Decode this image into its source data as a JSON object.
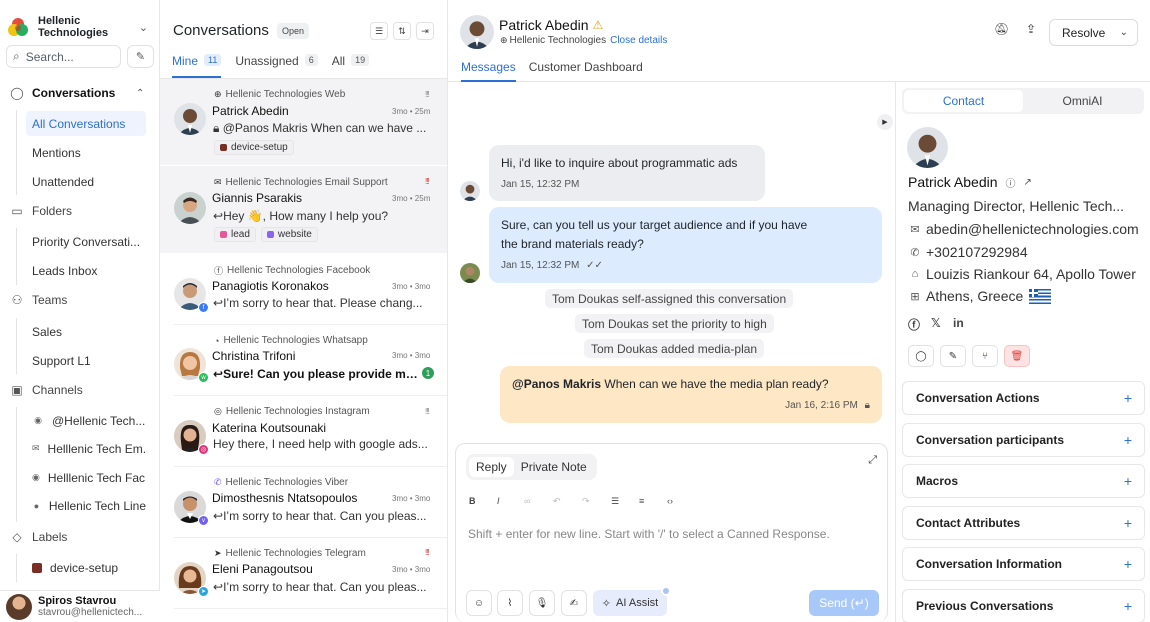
{
  "sidebar": {
    "org_name": "Hellenic Technologies",
    "search_placeholder": "Search...",
    "conversations_label": "Conversations",
    "conversation_items": [
      "All Conversations",
      "Mentions",
      "Unattended"
    ],
    "folders_label": "Folders",
    "folder_items": [
      "Priority Conversati...",
      "Leads Inbox"
    ],
    "teams_label": "Teams",
    "team_items": [
      "Sales",
      "Support L1"
    ],
    "channels_label": "Channels",
    "channel_items": [
      "@Hellenic Tech...",
      "Helllenic Tech Em...",
      "Helllenic Tech Fac...",
      "Hellenic Tech Line"
    ],
    "labels_label": "Labels",
    "label_items": [
      "device-setup"
    ],
    "user": {
      "name": "Spiros Stavrou",
      "email": "stavrou@hellenictech..."
    }
  },
  "conv_list": {
    "title": "Conversations",
    "status_badge": "Open",
    "tabs": [
      {
        "label": "Mine",
        "count": "11"
      },
      {
        "label": "Unassigned",
        "count": "6"
      },
      {
        "label": "All",
        "count": "19"
      }
    ],
    "items": [
      {
        "channel": "Hellenic Technologies Web",
        "name": "Patrick Abedin",
        "time": "3mo • 25m",
        "priority": "!!!",
        "message": "@Panos Makris When can we have ...",
        "labels": [
          {
            "text": "device-setup",
            "color": "#7a2d24"
          }
        ]
      },
      {
        "channel": "Hellenic Technologies Email Support",
        "name": "Giannis Psarakis",
        "time": "3mo • 25m",
        "priority": "!!!",
        "message": "Hey 👋, How many I help you?",
        "labels": [
          {
            "text": "lead",
            "color": "#e7589a"
          },
          {
            "text": "website",
            "color": "#8a63f0"
          }
        ]
      },
      {
        "channel": "Hellenic Technologies Facebook",
        "name": "Panagiotis Koronakos",
        "time": "3mo • 3mo",
        "priority": "",
        "message": "I’m sorry to hear that. Please chang...",
        "labels": []
      },
      {
        "channel": "Hellenic Technologies Whatsapp",
        "name": "Christina Trifoni",
        "time": "3mo • 3mo",
        "priority": "",
        "message": "Sure! Can you please provide me wi...",
        "labels": [],
        "unread": "1"
      },
      {
        "channel": "Hellenic Technologies Instagram",
        "name": "Katerina Koutsounaki",
        "time": "",
        "priority": "!!!",
        "message": "Hey there, I need help with google ads...",
        "labels": []
      },
      {
        "channel": "Hellenic Technologies Viber",
        "name": "Dimosthesnis Ntatsopoulos",
        "time": "3mo • 3mo",
        "priority": "",
        "message": "I’m sorry to hear that. Can you pleas...",
        "labels": []
      },
      {
        "channel": "Hellenic Technologies Telegram",
        "name": "Eleni Panagoutsou",
        "time": "3mo • 3mo",
        "priority": "!!!",
        "message": "I’m sorry to hear that. Can you pleas...",
        "labels": []
      }
    ]
  },
  "header": {
    "contact_name": "Patrick Abedin",
    "inbox_name": "Hellenic Technologies",
    "close_details": "Close details",
    "resolve_label": "Resolve",
    "tabs": [
      "Messages",
      "Customer Dashboard"
    ]
  },
  "messages": {
    "incoming_text": "Hi, i'd like to inquire about programmatic ads",
    "incoming_time": "Jan 15, 12:32 PM",
    "outgoing_line1": "Sure, can you tell us your target audience and if you have",
    "outgoing_line2": "the brand materials ready?",
    "outgoing_time": "Jan 15, 12:32 PM",
    "activities": [
      "Tom Doukas self-assigned this conversation",
      "Tom Doukas set the priority to high",
      "Tom Doukas added media-plan"
    ],
    "note_mention": "@Panos Makris",
    "note_text": " When can we have the media plan ready?",
    "note_time": "Jan 16, 2:16 PM"
  },
  "reply": {
    "tabs": [
      "Reply",
      "Private Note"
    ],
    "placeholder": "Shift + enter for new line. Start with '/' to select a Canned Response.",
    "ai_assist": "AI Assist",
    "send_label": "Send (↵)"
  },
  "contact_panel": {
    "tabs": [
      "Contact",
      "OmniAI"
    ],
    "name": "Patrick Abedin",
    "title": "Managing Director, Hellenic Tech...",
    "email": "abedin@hellenictechnologies.com",
    "phone": "+302107292984",
    "address": "Louizis Riankour 64, Apollo Tower",
    "location": "Athens, Greece",
    "sections": [
      "Conversation Actions",
      "Conversation participants",
      "Macros",
      "Contact Attributes",
      "Conversation Information",
      "Previous Conversations"
    ]
  },
  "colors": {
    "accent": "#2b6fd8",
    "incoming_bubble": "#ecedf0",
    "outgoing_bubble": "#dcebfd",
    "note_bubble": "#fde7c4",
    "priority_red": "#d9403a"
  }
}
